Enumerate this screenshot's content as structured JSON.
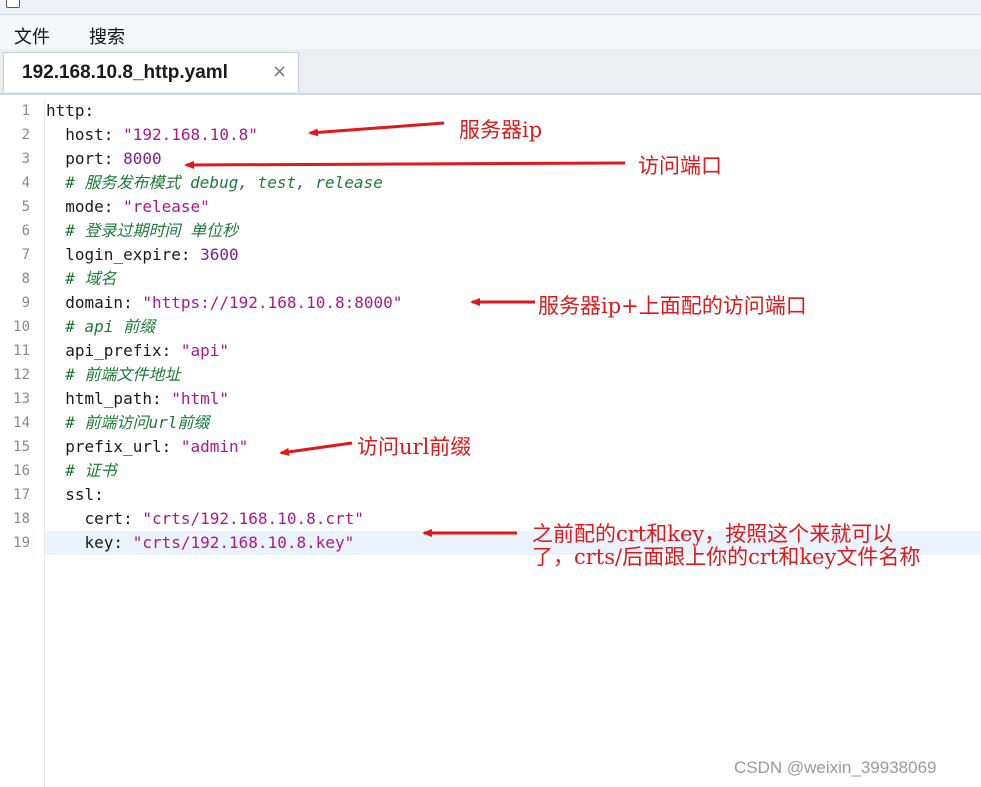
{
  "window": {
    "title": ""
  },
  "menu": {
    "file": "文件",
    "search": "搜索"
  },
  "tab": {
    "filename": "192.168.10.8_http.yaml",
    "close_glyph": "×"
  },
  "editor": {
    "current_line": 19,
    "lines": [
      {
        "n": "1",
        "tokens": [
          [
            "k",
            "http:"
          ]
        ]
      },
      {
        "n": "2",
        "tokens": [
          [
            "k",
            "  host: "
          ],
          [
            "s",
            "\"192.168.10.8\""
          ]
        ]
      },
      {
        "n": "3",
        "tokens": [
          [
            "k",
            "  port: "
          ],
          [
            "n",
            "8000"
          ]
        ]
      },
      {
        "n": "4",
        "tokens": [
          [
            "c",
            "  # 服务发布模式 debug, test, release"
          ]
        ]
      },
      {
        "n": "5",
        "tokens": [
          [
            "k",
            "  mode: "
          ],
          [
            "s",
            "\"release\""
          ]
        ]
      },
      {
        "n": "6",
        "tokens": [
          [
            "c",
            "  # 登录过期时间 单位秒"
          ]
        ]
      },
      {
        "n": "7",
        "tokens": [
          [
            "k",
            "  login_expire: "
          ],
          [
            "n",
            "3600"
          ]
        ]
      },
      {
        "n": "8",
        "tokens": [
          [
            "c",
            "  # 域名"
          ]
        ]
      },
      {
        "n": "9",
        "tokens": [
          [
            "k",
            "  domain: "
          ],
          [
            "s",
            "\"https://192.168.10.8:8000\""
          ]
        ]
      },
      {
        "n": "10",
        "tokens": [
          [
            "c",
            "  # api 前缀"
          ]
        ]
      },
      {
        "n": "11",
        "tokens": [
          [
            "k",
            "  api_prefix: "
          ],
          [
            "s",
            "\"api\""
          ]
        ]
      },
      {
        "n": "12",
        "tokens": [
          [
            "c",
            "  # 前端文件地址"
          ]
        ]
      },
      {
        "n": "13",
        "tokens": [
          [
            "k",
            "  html_path: "
          ],
          [
            "s",
            "\"html\""
          ]
        ]
      },
      {
        "n": "14",
        "tokens": [
          [
            "c",
            "  # 前端访问url前缀"
          ]
        ]
      },
      {
        "n": "15",
        "tokens": [
          [
            "k",
            "  prefix_url: "
          ],
          [
            "s",
            "\"admin\""
          ]
        ]
      },
      {
        "n": "16",
        "tokens": [
          [
            "c",
            "  # 证书"
          ]
        ]
      },
      {
        "n": "17",
        "tokens": [
          [
            "k",
            "  ssl:"
          ]
        ]
      },
      {
        "n": "18",
        "tokens": [
          [
            "k",
            "    cert: "
          ],
          [
            "s",
            "\"crts/192.168.10.8.crt\""
          ]
        ]
      },
      {
        "n": "19",
        "tokens": [
          [
            "k",
            "    key: "
          ],
          [
            "s",
            "\"crts/192.168.10.8.key\""
          ]
        ]
      }
    ]
  },
  "annotations": {
    "server_ip": "服务器ip",
    "access_port": "访问端口",
    "domain_note": "服务器ip+上面配的访问端口",
    "prefix_note": "访问url前缀",
    "ssl_note_line1": "之前配的crt和key，按照这个来就可以",
    "ssl_note_line2": "了，crts/后面跟上你的crt和key文件名称"
  },
  "colors": {
    "annotation": "#e0181b",
    "string": "#b0178a",
    "number": "#7a1fa2",
    "comment": "#1f7a3a",
    "current_line": "#eaf2fb"
  },
  "watermark": "CSDN @weixin_39938069"
}
